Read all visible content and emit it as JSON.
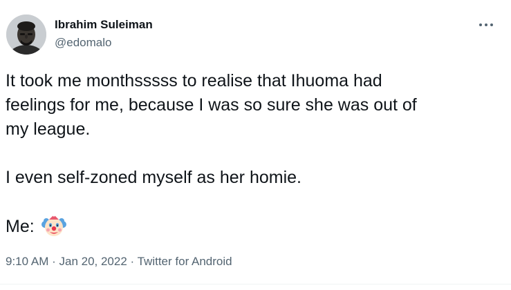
{
  "author": {
    "display_name": "Ibrahim Suleiman",
    "handle": "@edomalo"
  },
  "tweet": {
    "line1": "It took me monthsssss to realise that Ihuoma had",
    "line2": "feelings for me, because I was so sure she was out of",
    "line3": "my league.",
    "line4": "I even self-zoned myself as her homie.",
    "line5": "Me:",
    "emoji": "clown-face-emoji"
  },
  "meta": {
    "time": "9:10 AM",
    "separator1": " · ",
    "date": "Jan 20, 2022",
    "separator2": " · ",
    "source": "Twitter for Android"
  },
  "colors": {
    "text_primary": "#0f1419",
    "text_secondary": "#536471",
    "divider": "#eff3f4"
  }
}
